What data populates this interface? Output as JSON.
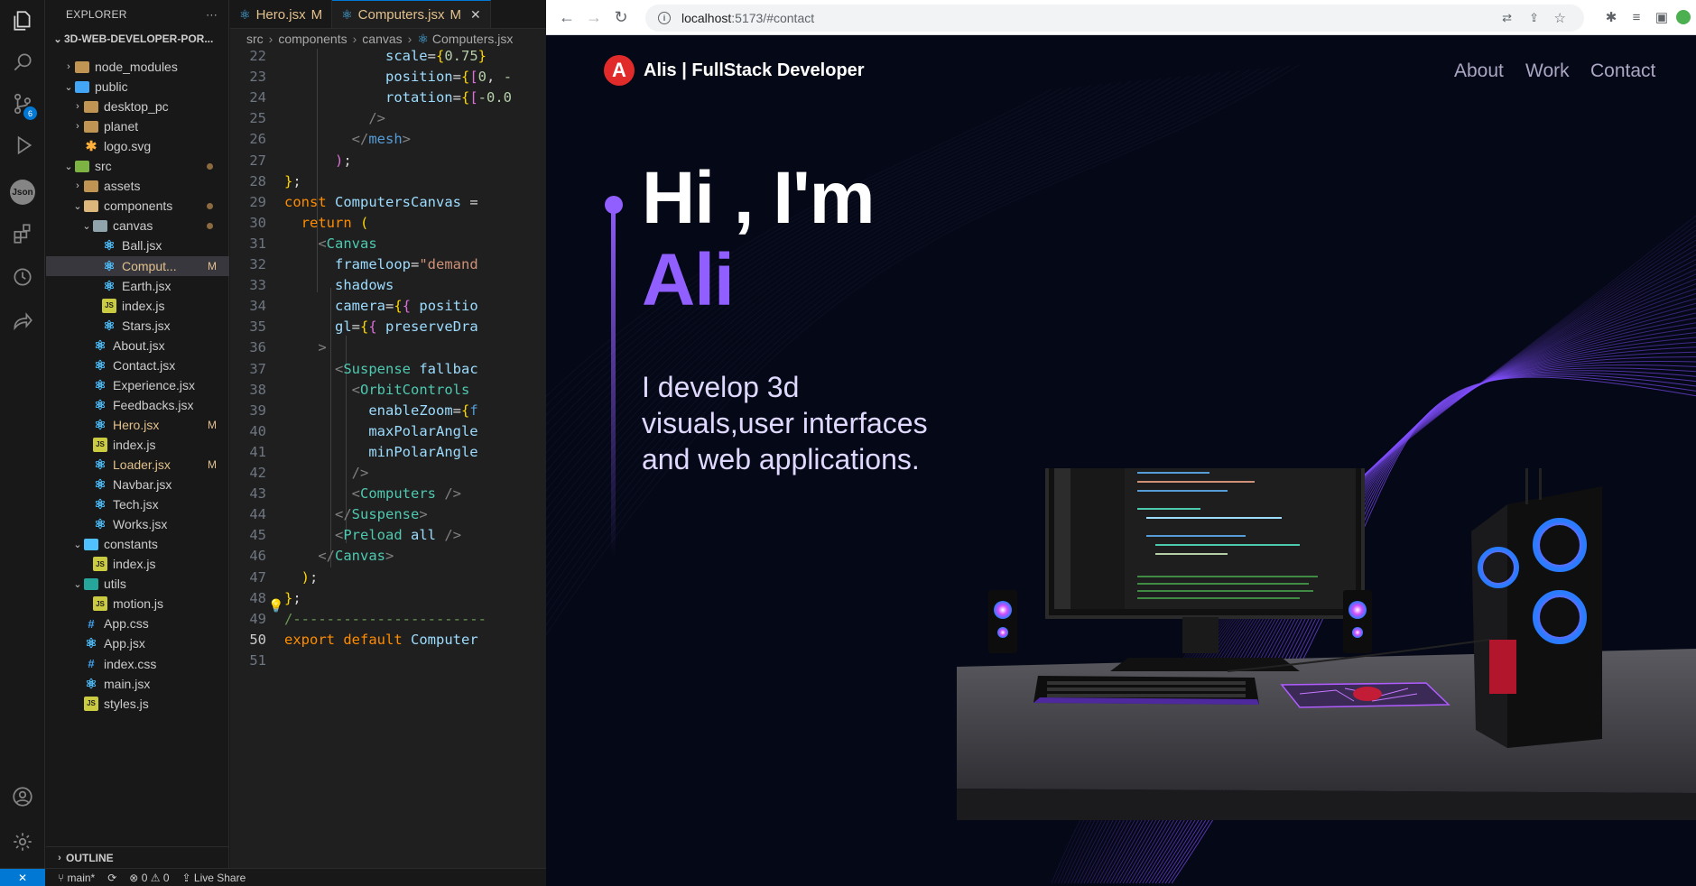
{
  "vscode": {
    "explorer_title": "EXPLORER",
    "more_label": "···",
    "project": "3D-WEB-DEVELOPER-POR...",
    "source_control_badge": "6",
    "json_label": "Json",
    "tree": [
      {
        "label": "node_modules",
        "depth": 1,
        "kind": "folder",
        "expanded": false
      },
      {
        "label": "public",
        "depth": 1,
        "kind": "folder-blue",
        "expanded": true
      },
      {
        "label": "desktop_pc",
        "depth": 2,
        "kind": "folder",
        "expanded": false
      },
      {
        "label": "planet",
        "depth": 2,
        "kind": "folder",
        "expanded": false
      },
      {
        "label": "logo.svg",
        "depth": 2,
        "kind": "svg"
      },
      {
        "label": "src",
        "depth": 1,
        "kind": "folder-green",
        "expanded": true,
        "dot": true
      },
      {
        "label": "assets",
        "depth": 2,
        "kind": "folder",
        "expanded": false
      },
      {
        "label": "components",
        "depth": 2,
        "kind": "folder-open",
        "expanded": true,
        "dot": true,
        "modified": true
      },
      {
        "label": "canvas",
        "depth": 3,
        "kind": "folder-gray",
        "expanded": true,
        "dot": true,
        "modified": true
      },
      {
        "label": "Ball.jsx",
        "depth": 4,
        "kind": "react"
      },
      {
        "label": "Comput...",
        "depth": 4,
        "kind": "react",
        "modified": true,
        "flag": "M",
        "selected": true
      },
      {
        "label": "Earth.jsx",
        "depth": 4,
        "kind": "react"
      },
      {
        "label": "index.js",
        "depth": 4,
        "kind": "js"
      },
      {
        "label": "Stars.jsx",
        "depth": 4,
        "kind": "react"
      },
      {
        "label": "About.jsx",
        "depth": 3,
        "kind": "react"
      },
      {
        "label": "Contact.jsx",
        "depth": 3,
        "kind": "react"
      },
      {
        "label": "Experience.jsx",
        "depth": 3,
        "kind": "react"
      },
      {
        "label": "Feedbacks.jsx",
        "depth": 3,
        "kind": "react"
      },
      {
        "label": "Hero.jsx",
        "depth": 3,
        "kind": "react",
        "modified": true,
        "flag": "M"
      },
      {
        "label": "index.js",
        "depth": 3,
        "kind": "js"
      },
      {
        "label": "Loader.jsx",
        "depth": 3,
        "kind": "react",
        "modified": true,
        "flag": "M"
      },
      {
        "label": "Navbar.jsx",
        "depth": 3,
        "kind": "react"
      },
      {
        "label": "Tech.jsx",
        "depth": 3,
        "kind": "react"
      },
      {
        "label": "Works.jsx",
        "depth": 3,
        "kind": "react"
      },
      {
        "label": "constants",
        "depth": 2,
        "kind": "folder-teal",
        "expanded": true
      },
      {
        "label": "index.js",
        "depth": 3,
        "kind": "js"
      },
      {
        "label": "utils",
        "depth": 2,
        "kind": "folder-cyan",
        "expanded": true
      },
      {
        "label": "motion.js",
        "depth": 3,
        "kind": "js"
      },
      {
        "label": "App.css",
        "depth": 2,
        "kind": "css"
      },
      {
        "label": "App.jsx",
        "depth": 2,
        "kind": "react"
      },
      {
        "label": "index.css",
        "depth": 2,
        "kind": "css"
      },
      {
        "label": "main.jsx",
        "depth": 2,
        "kind": "react"
      },
      {
        "label": "styles.js",
        "depth": 2,
        "kind": "js"
      }
    ],
    "outline_label": "OUTLINE",
    "tabs": [
      {
        "label": "Hero.jsx",
        "flag": "M",
        "active": false
      },
      {
        "label": "Computers.jsx",
        "flag": "M",
        "active": true,
        "close": "✕"
      }
    ],
    "breadcrumb": [
      "src",
      "components",
      "canvas",
      "Computers.jsx"
    ],
    "current_line": "50",
    "code_lines": [
      {
        "n": "22",
        "html": "            <span class=\"a\">scale</span><span class=\"p\">=</span><span class=\"y\">{</span><span class=\"n\">0.75</span><span class=\"y\">}</span>"
      },
      {
        "n": "23",
        "html": "            <span class=\"a\">position</span><span class=\"p\">=</span><span class=\"y\">{</span><span class=\"pk\">[</span><span class=\"n\">0</span>, <span class=\"n\">-</span>"
      },
      {
        "n": "24",
        "html": "            <span class=\"a\">rotation</span><span class=\"p\">=</span><span class=\"y\">{</span><span class=\"pk\">[</span><span class=\"n\">-0.0</span>"
      },
      {
        "n": "25",
        "html": "          <span class=\"gr\">/&gt;</span>"
      },
      {
        "n": "26",
        "html": "        <span class=\"gr\">&lt;/</span><span class=\"k\">mesh</span><span class=\"gr\">&gt;</span>"
      },
      {
        "n": "27",
        "html": "      <span class=\"pk\">)</span>;"
      },
      {
        "n": "28",
        "html": "<span class=\"y\">}</span>;"
      },
      {
        "n": "29",
        "html": "<span class=\"o\">const</span> <span class=\"a\">ComputersCanvas</span> ="
      },
      {
        "n": "30",
        "html": "  <span class=\"o\">return</span> <span class=\"y\">(</span>"
      },
      {
        "n": "31",
        "html": "    <span class=\"gr\">&lt;</span><span class=\"t\">Canvas</span>"
      },
      {
        "n": "32",
        "html": "      <span class=\"a\">frameloop</span>=<span class=\"s\">\"demand</span>"
      },
      {
        "n": "33",
        "html": "      <span class=\"a\">shadows</span>"
      },
      {
        "n": "34",
        "html": "      <span class=\"a\">camera</span>=<span class=\"y\">{</span><span class=\"pk\">{</span> <span class=\"a\">positio</span>"
      },
      {
        "n": "35",
        "html": "      <span class=\"a\">gl</span>=<span class=\"y\">{</span><span class=\"pk\">{</span> <span class=\"a\">preserveDra</span>"
      },
      {
        "n": "36",
        "html": "    <span class=\"gr\">&gt;</span>"
      },
      {
        "n": "37",
        "html": "      <span class=\"gr\">&lt;</span><span class=\"t\">Suspense</span> <span class=\"a\">fallbac</span>"
      },
      {
        "n": "38",
        "html": "        <span class=\"gr\">&lt;</span><span class=\"t\">OrbitControls</span>"
      },
      {
        "n": "39",
        "html": "          <span class=\"a\">enableZoom</span>=<span class=\"y\">{</span><span class=\"k\">f</span>"
      },
      {
        "n": "40",
        "html": "          <span class=\"a\">maxPolarAngle</span>"
      },
      {
        "n": "41",
        "html": "          <span class=\"a\">minPolarAngle</span>"
      },
      {
        "n": "42",
        "html": "        <span class=\"gr\">/&gt;</span>"
      },
      {
        "n": "43",
        "html": "        <span class=\"gr\">&lt;</span><span class=\"t\">Computers</span> <span class=\"gr\">/&gt;</span>"
      },
      {
        "n": "44",
        "html": "      <span class=\"gr\">&lt;/</span><span class=\"t\">Suspense</span><span class=\"gr\">&gt;</span>"
      },
      {
        "n": "45",
        "html": "      <span class=\"gr\">&lt;</span><span class=\"t\">Preload</span> <span class=\"a\">all</span> <span class=\"gr\">/&gt;</span>"
      },
      {
        "n": "46",
        "html": "    <span class=\"gr\">&lt;/</span><span class=\"t\">Canvas</span><span class=\"gr\">&gt;</span>"
      },
      {
        "n": "47",
        "html": "  <span class=\"y\">)</span>;"
      },
      {
        "n": "48",
        "html": "<span class=\"y\">}</span>;"
      },
      {
        "n": "49",
        "html": "<span class=\"c\">/-----------------------</span>"
      },
      {
        "n": "50",
        "html": "<span class=\"o\">export</span> <span class=\"o\">default</span> <span class=\"a\">Computer</span>"
      },
      {
        "n": "51",
        "html": ""
      }
    ],
    "status": {
      "remote": "✕",
      "branch": "main*",
      "errors": "0",
      "warnings": "0",
      "live_share": "Live Share"
    }
  },
  "browser": {
    "url_host": "localhost",
    "url_rest": ":5173/#contact"
  },
  "site": {
    "logo_letter": "A",
    "brand": "Alis | FullStack Developer",
    "nav": [
      "About",
      "Work",
      "Contact"
    ],
    "greeting": "Hi , I'm",
    "name": "Ali",
    "subtitle": "I develop 3d visuals,user interfaces and web applications.",
    "colors": {
      "accent": "#915eff",
      "bg": "#050816",
      "logo": "#e12b2b"
    }
  }
}
